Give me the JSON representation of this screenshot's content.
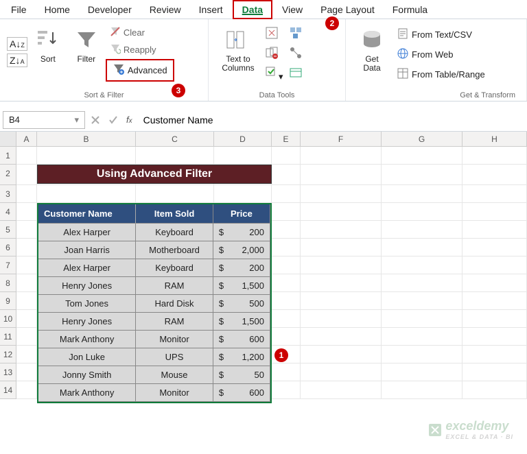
{
  "menu": {
    "items": [
      "File",
      "Home",
      "Developer",
      "Review",
      "Insert",
      "Data",
      "View",
      "Page Layout",
      "Formula"
    ],
    "active": "Data"
  },
  "ribbon": {
    "sort": "Sort",
    "filter": "Filter",
    "clear": "Clear",
    "reapply": "Reapply",
    "advanced": "Advanced",
    "text_to_columns": "Text to\nColumns",
    "get_data": "Get\nData",
    "from_text_csv": "From Text/CSV",
    "from_web": "From Web",
    "from_table_range": "From Table/Range",
    "group1": "Sort & Filter",
    "group2": "Data Tools",
    "group3": "Get & Transform"
  },
  "badges": {
    "b1": "1",
    "b2": "2",
    "b3": "3"
  },
  "formula_bar": {
    "name_box": "B4",
    "formula": "Customer Name"
  },
  "columns": [
    "A",
    "B",
    "C",
    "D",
    "E",
    "F",
    "G",
    "H"
  ],
  "row_nums": [
    "1",
    "2",
    "3",
    "4",
    "5",
    "6",
    "7",
    "8",
    "9",
    "10",
    "11",
    "12",
    "13",
    "14"
  ],
  "title": "Using Advanced Filter",
  "table": {
    "headers": {
      "name": "Customer Name",
      "item": "Item Sold",
      "price": "Price"
    },
    "currency": "$",
    "rows": [
      {
        "name": "Alex Harper",
        "item": "Keyboard",
        "price": "200"
      },
      {
        "name": "Joan Harris",
        "item": "Motherboard",
        "price": "2,000"
      },
      {
        "name": "Alex Harper",
        "item": "Keyboard",
        "price": "200"
      },
      {
        "name": "Henry Jones",
        "item": "RAM",
        "price": "1,500"
      },
      {
        "name": "Tom Jones",
        "item": "Hard Disk",
        "price": "500"
      },
      {
        "name": "Henry Jones",
        "item": "RAM",
        "price": "1,500"
      },
      {
        "name": "Mark Anthony",
        "item": "Monitor",
        "price": "600"
      },
      {
        "name": "Jon Luke",
        "item": "UPS",
        "price": "1,200"
      },
      {
        "name": "Jonny Smith",
        "item": "Mouse",
        "price": "50"
      },
      {
        "name": "Mark Anthony",
        "item": "Monitor",
        "price": "600"
      }
    ]
  },
  "watermark": {
    "brand": "exceldemy",
    "tag": "EXCEL & DATA · BI"
  }
}
